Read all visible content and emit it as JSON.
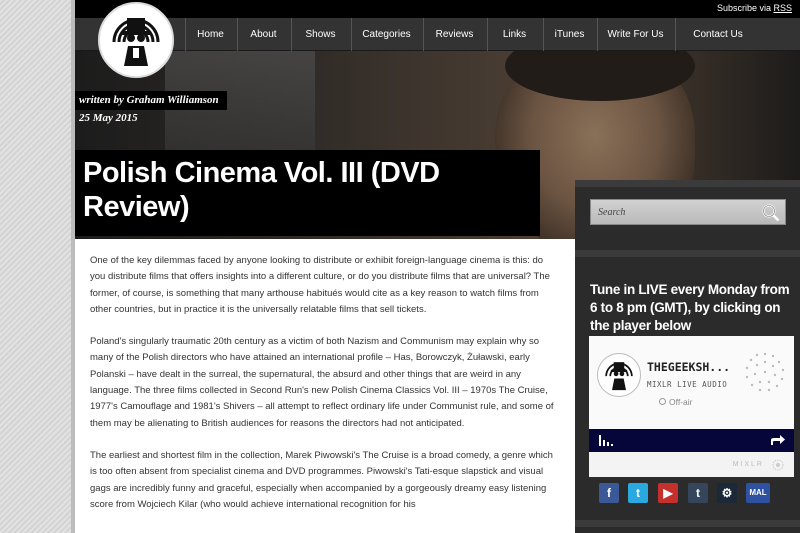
{
  "header": {
    "subscribe_text": "Subscribe via",
    "subscribe_link": "RSS"
  },
  "nav": {
    "items": [
      {
        "label": "Home"
      },
      {
        "label": "About"
      },
      {
        "label": "Shows"
      },
      {
        "label": "Categories"
      },
      {
        "label": "Reviews"
      },
      {
        "label": "Links"
      },
      {
        "label": "iTunes"
      },
      {
        "label": "Write For Us"
      },
      {
        "label": "Contact Us"
      }
    ]
  },
  "post": {
    "byline": "written by Graham Williamson",
    "date": "25 May 2015",
    "title": "Polish Cinema Vol. III (DVD Review)",
    "paragraphs": [
      "One of the key dilemmas faced by anyone looking to distribute or exhibit foreign-language cinema is this: do you distribute films that offers insights into a different culture, or do you distribute films that are universal? The former, of course, is something that many arthouse habitués would cite as a key reason to watch films from other countries, but in practice it is the universally relatable films that sell tickets.",
      "Poland's singularly traumatic 20th century as a victim of both Nazism and Communism may explain why so many of the Polish directors who have attained an international profile – Has, Borowczyk, Żuławski, early Polanski – have dealt in the surreal, the supernatural, the absurd and other things that are weird in any language. The three films collected in Second Run's new Polish Cinema Classics Vol. III – 1970s The Cruise, 1977's Camouflage and 1981's Shivers – all attempt to reflect ordinary life under Communist rule, and some of them may be alienating to British audiences for reasons the directors had not anticipated.",
      "The earliest and shortest film in the collection, Marek Piwowski's The Cruise is a broad comedy, a genre which is too often absent from specialist cinema and DVD programmes. Piwowski's Tati-esque slapstick and visual gags are incredibly funny and graceful, especially when accompanied by a gorgeously dreamy easy listening score from Wojciech Kilar (who would achieve international recognition for his"
    ]
  },
  "sidebar": {
    "search_placeholder": "Search",
    "tune_in": "Tune in LIVE every Monday from 6 to 8 pm (GMT), by clicking on the player below",
    "player": {
      "name": "THEGEEKSH...",
      "subtitle": "MIXLR LIVE AUDIO",
      "status": "Off-air",
      "brand": "MIXLR"
    },
    "social": [
      {
        "icon": "facebook-icon",
        "glyph": "f",
        "color": "#3b5998"
      },
      {
        "icon": "twitter-icon",
        "glyph": "t",
        "color": "#2aa9e0"
      },
      {
        "icon": "youtube-icon",
        "glyph": "▶",
        "color": "#c4302b"
      },
      {
        "icon": "tumblr-icon",
        "glyph": "t",
        "color": "#35465c"
      },
      {
        "icon": "steam-icon",
        "glyph": "⚙",
        "color": "#1b2838"
      },
      {
        "icon": "mal-icon",
        "glyph": "MAL",
        "color": "#2e51a2"
      }
    ]
  }
}
